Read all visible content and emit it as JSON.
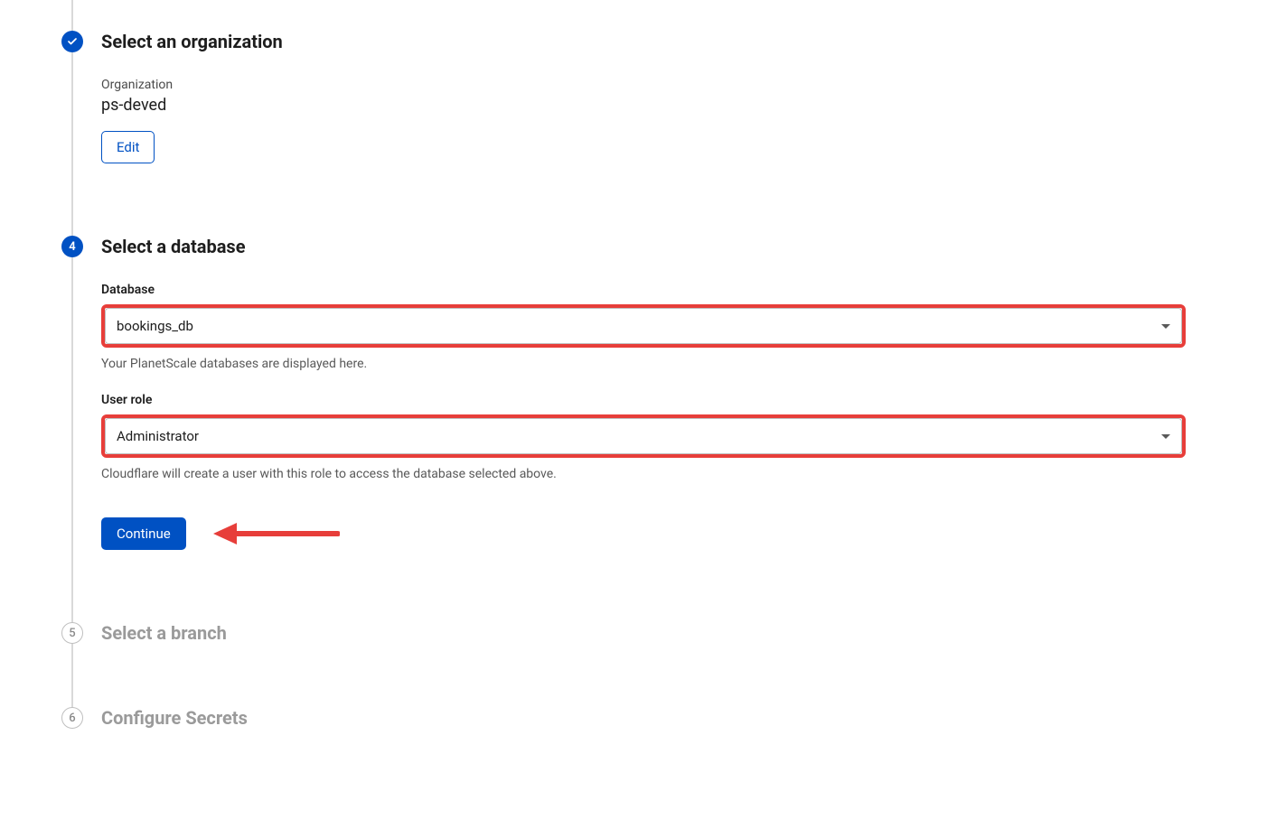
{
  "steps": {
    "org": {
      "title": "Select an organization",
      "field_label": "Organization",
      "field_value": "ps-deved",
      "edit_label": "Edit"
    },
    "db": {
      "number": "4",
      "title": "Select a database",
      "database_label": "Database",
      "database_value": "bookings_db",
      "database_help": "Your PlanetScale databases are displayed here.",
      "role_label": "User role",
      "role_value": "Administrator",
      "role_help": "Cloudflare will create a user with this role to access the database selected above.",
      "continue_label": "Continue"
    },
    "branch": {
      "number": "5",
      "title": "Select a branch"
    },
    "secrets": {
      "number": "6",
      "title": "Configure Secrets"
    }
  }
}
